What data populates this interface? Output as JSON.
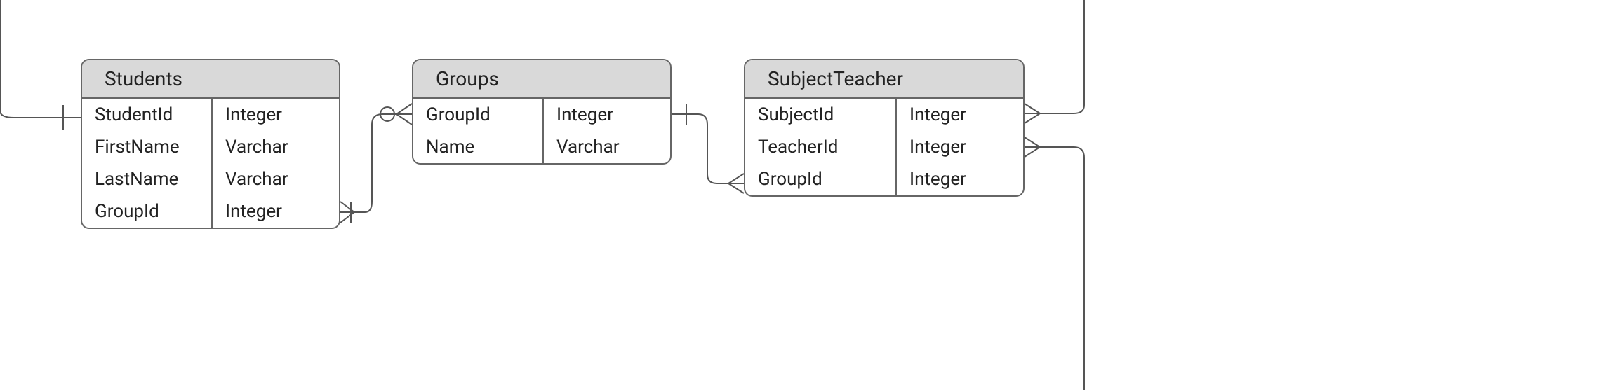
{
  "entities": {
    "students": {
      "title": "Students",
      "columns": [
        {
          "name": "StudentId",
          "type": "Integer"
        },
        {
          "name": "FirstName",
          "type": "Varchar"
        },
        {
          "name": "LastName",
          "type": "Varchar"
        },
        {
          "name": "GroupId",
          "type": "Integer"
        }
      ]
    },
    "groups": {
      "title": "Groups",
      "columns": [
        {
          "name": "GroupId",
          "type": "Integer"
        },
        {
          "name": "Name",
          "type": "Varchar"
        }
      ]
    },
    "subjectTeacher": {
      "title": "SubjectTeacher",
      "columns": [
        {
          "name": "SubjectId",
          "type": "Integer"
        },
        {
          "name": "TeacherId",
          "type": "Integer"
        },
        {
          "name": "GroupId",
          "type": "Integer"
        }
      ]
    }
  },
  "relations": [
    {
      "from": "Students.GroupId",
      "to": "Groups.GroupId",
      "from_card": "many-mandatory",
      "to_card": "one-optional"
    },
    {
      "from": "SubjectTeacher.GroupId",
      "to": "Groups.GroupId",
      "from_card": "many",
      "to_card": "one-mandatory"
    }
  ]
}
